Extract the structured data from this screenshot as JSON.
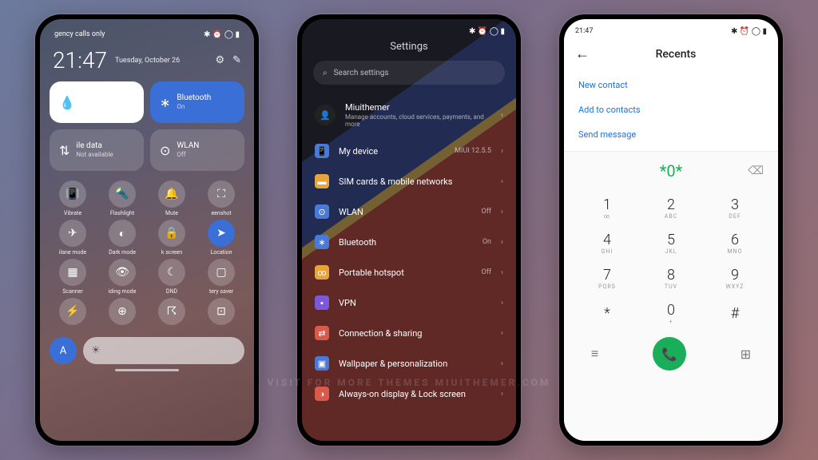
{
  "watermark": "visit for more themes miuithemer.com",
  "statusTime": "21:47",
  "phone1": {
    "statusLeft": "gency calls only",
    "date": "Tuesday, October 26",
    "tiles": {
      "bluetooth": {
        "label": "Bluetooth",
        "sub": "On"
      },
      "data": {
        "label": "ile data",
        "sub": "Not available"
      },
      "wlan": {
        "label": "WLAN",
        "sub": "Off"
      }
    },
    "toggles": [
      {
        "label": "Vibrate",
        "icon": "📳"
      },
      {
        "label": "Flashlight",
        "icon": "🔦"
      },
      {
        "label": "Mute",
        "icon": "🔔"
      },
      {
        "label": "eenshot",
        "icon": "⛶"
      },
      {
        "label": "ilane mode",
        "icon": "✈"
      },
      {
        "label": "Dark mode",
        "icon": "◐"
      },
      {
        "label": "k screen",
        "icon": "🔒"
      },
      {
        "label": "Location",
        "icon": "➤",
        "on": true
      },
      {
        "label": "Scanner",
        "icon": "▦"
      },
      {
        "label": "iding mode",
        "icon": "👁"
      },
      {
        "label": "DND",
        "icon": "☾"
      },
      {
        "label": "tery saver",
        "icon": "▢"
      },
      {
        "label": "",
        "icon": "⚡"
      },
      {
        "label": "",
        "icon": "⊕"
      },
      {
        "label": "",
        "icon": "☈"
      },
      {
        "label": "",
        "icon": "⊡"
      }
    ]
  },
  "phone2": {
    "title": "Settings",
    "searchPlaceholder": "Search settings",
    "account": {
      "label": "Miuithemer",
      "sub": "Manage accounts, cloud services, payments, and more"
    },
    "items": [
      {
        "icon": "📱",
        "color": "#4a7ad8",
        "label": "My device",
        "val": "MIUI 12.5.5"
      },
      {
        "icon": "▬",
        "color": "#e6a43a",
        "label": "SIM cards & mobile networks",
        "val": ""
      },
      {
        "icon": "⊙",
        "color": "#4a7ad8",
        "label": "WLAN",
        "val": "Off"
      },
      {
        "icon": "∗",
        "color": "#4a7ad8",
        "label": "Bluetooth",
        "val": "On"
      },
      {
        "icon": "∞",
        "color": "#e6a43a",
        "label": "Portable hotspot",
        "val": "Off"
      },
      {
        "icon": "▪",
        "color": "#7a5ad8",
        "label": "VPN",
        "val": ""
      },
      {
        "icon": "⇄",
        "color": "#d85a4a",
        "label": "Connection & sharing",
        "val": ""
      },
      {
        "icon": "▣",
        "color": "#4a7ad8",
        "label": "Wallpaper & personalization",
        "val": ""
      },
      {
        "icon": "◑",
        "color": "#d85a4a",
        "label": "Always-on display & Lock screen",
        "val": ""
      }
    ]
  },
  "phone3": {
    "title": "Recents",
    "links": [
      "New contact",
      "Add to contacts",
      "Send message"
    ],
    "dialed": "*0*",
    "keys": [
      {
        "n": "1",
        "l": "∞"
      },
      {
        "n": "2",
        "l": "ABC"
      },
      {
        "n": "3",
        "l": "DEF"
      },
      {
        "n": "4",
        "l": "GHI"
      },
      {
        "n": "5",
        "l": "JKL"
      },
      {
        "n": "6",
        "l": "MNO"
      },
      {
        "n": "7",
        "l": "PQRS"
      },
      {
        "n": "8",
        "l": "TUV"
      },
      {
        "n": "9",
        "l": "WXYZ"
      },
      {
        "n": "*",
        "l": ""
      },
      {
        "n": "0",
        "l": "+"
      },
      {
        "n": "#",
        "l": ""
      }
    ]
  }
}
